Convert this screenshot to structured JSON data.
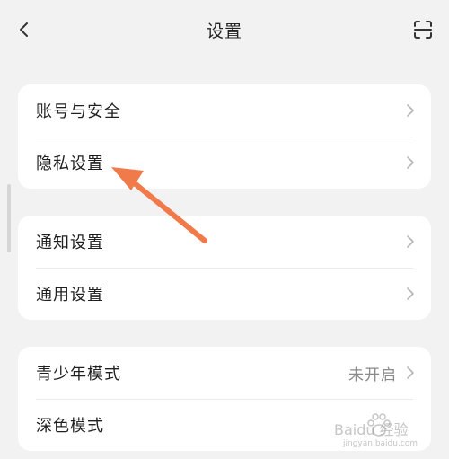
{
  "nav": {
    "title": "设置",
    "back_icon": "chevron-left-icon",
    "scan_icon": "scan-icon"
  },
  "groups": [
    {
      "items": [
        {
          "label": "账号与安全"
        },
        {
          "label": "隐私设置"
        }
      ]
    },
    {
      "items": [
        {
          "label": "通知设置"
        },
        {
          "label": "通用设置"
        }
      ]
    },
    {
      "items": [
        {
          "label": "青少年模式",
          "value": "未开启"
        },
        {
          "label": "深色模式"
        }
      ]
    }
  ],
  "annotation": {
    "arrow_color": "#f07a4a"
  },
  "watermark": {
    "brand": "Baidu 经验",
    "url": "jingyan.baidu.com"
  }
}
